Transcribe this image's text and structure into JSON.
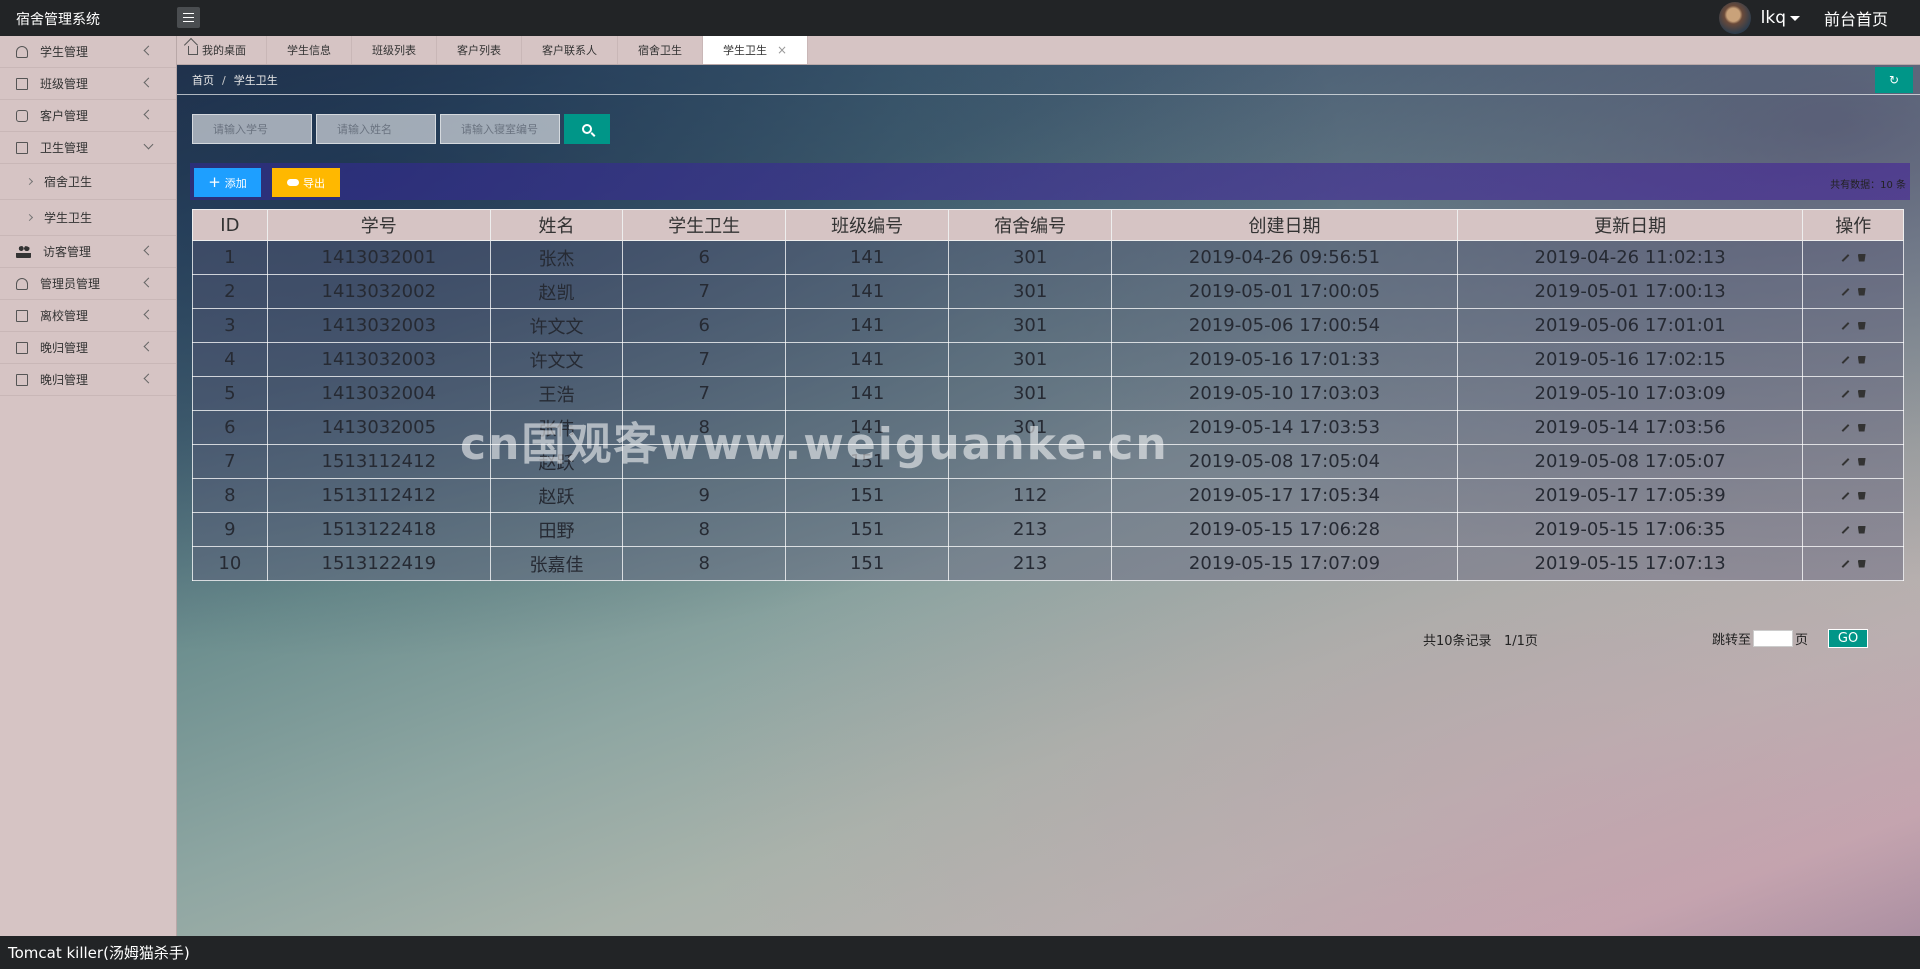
{
  "header": {
    "app_title": "宿舍管理系统",
    "user_name": "lkq",
    "front_link": "前台首页"
  },
  "sidebar": {
    "items": [
      {
        "label": "学生管理",
        "icon": "user-icon"
      },
      {
        "label": "班级管理",
        "icon": "document-icon"
      },
      {
        "label": "客户管理",
        "icon": "box-icon"
      },
      {
        "label": "卫生管理",
        "icon": "document-icon"
      },
      {
        "label": "访客管理",
        "icon": "group-icon"
      },
      {
        "label": "管理员管理",
        "icon": "user-icon"
      },
      {
        "label": "离校管理",
        "icon": "document-icon"
      },
      {
        "label": "晚归管理",
        "icon": "document-icon"
      },
      {
        "label": "晚归管理",
        "icon": "document-icon"
      }
    ],
    "sub_items": [
      {
        "label": "宿舍卫生"
      },
      {
        "label": "学生卫生"
      }
    ]
  },
  "tabs": [
    {
      "label": "我的桌面"
    },
    {
      "label": "学生信息"
    },
    {
      "label": "班级列表"
    },
    {
      "label": "客户列表"
    },
    {
      "label": "客户联系人"
    },
    {
      "label": "宿舍卫生"
    },
    {
      "label": "学生卫生",
      "close": "×"
    }
  ],
  "breadcrumb": {
    "home": "首页",
    "separator": "/",
    "current": "学生卫生",
    "refresh_glyph": "↻"
  },
  "search": {
    "student_id_placeholder": "请输入学号",
    "name_placeholder": "请输入姓名",
    "dorm_placeholder": "请输入寝室编号"
  },
  "toolbar": {
    "add_label": "添加",
    "add_glyph": "+",
    "export_label": "导出",
    "total_text": "共有数据：10 条"
  },
  "table": {
    "headers": [
      "ID",
      "学号",
      "姓名",
      "学生卫生",
      "班级编号",
      "宿舍编号",
      "创建日期",
      "更新日期",
      "操作"
    ],
    "rows": [
      [
        "1",
        "1413032001",
        "张杰",
        "6",
        "141",
        "301",
        "2019-04-26 09:56:51",
        "2019-04-26 11:02:13"
      ],
      [
        "2",
        "1413032002",
        "赵凯",
        "7",
        "141",
        "301",
        "2019-05-01 17:00:05",
        "2019-05-01 17:00:13"
      ],
      [
        "3",
        "1413032003",
        "许文文",
        "6",
        "141",
        "301",
        "2019-05-06 17:00:54",
        "2019-05-06 17:01:01"
      ],
      [
        "4",
        "1413032003",
        "许文文",
        "7",
        "141",
        "301",
        "2019-05-16 17:01:33",
        "2019-05-16 17:02:15"
      ],
      [
        "5",
        "1413032004",
        "王浩",
        "7",
        "141",
        "301",
        "2019-05-10 17:03:03",
        "2019-05-10 17:03:09"
      ],
      [
        "6",
        "1413032005",
        "张伟",
        "8",
        "141",
        "301",
        "2019-05-14 17:03:53",
        "2019-05-14 17:03:56"
      ],
      [
        "7",
        "1513112412",
        "赵跃",
        "",
        "151",
        "",
        "2019-05-08 17:05:04",
        "2019-05-08 17:05:07"
      ],
      [
        "8",
        "1513112412",
        "赵跃",
        "9",
        "151",
        "112",
        "2019-05-17 17:05:34",
        "2019-05-17 17:05:39"
      ],
      [
        "9",
        "1513122418",
        "田野",
        "8",
        "151",
        "213",
        "2019-05-15 17:06:28",
        "2019-05-15 17:06:35"
      ],
      [
        "10",
        "1513122419",
        "张嘉佳",
        "8",
        "151",
        "213",
        "2019-05-15 17:07:09",
        "2019-05-15 17:07:13"
      ]
    ]
  },
  "pager": {
    "total_text": "共10条记录",
    "page_text": "1/1页",
    "jump_prefix": "跳转至",
    "jump_suffix": "页",
    "go_label": "GO"
  },
  "watermark": "cn国观客www.weiguanke.cn",
  "footer": {
    "text": "Tomcat killer(汤姆猫杀手)"
  },
  "colors": {
    "primary": "#009688",
    "add": "#1e9fff",
    "export": "#ffb800",
    "sidebar_bg": "#d6c4c4",
    "topbar_bg": "#222426"
  }
}
